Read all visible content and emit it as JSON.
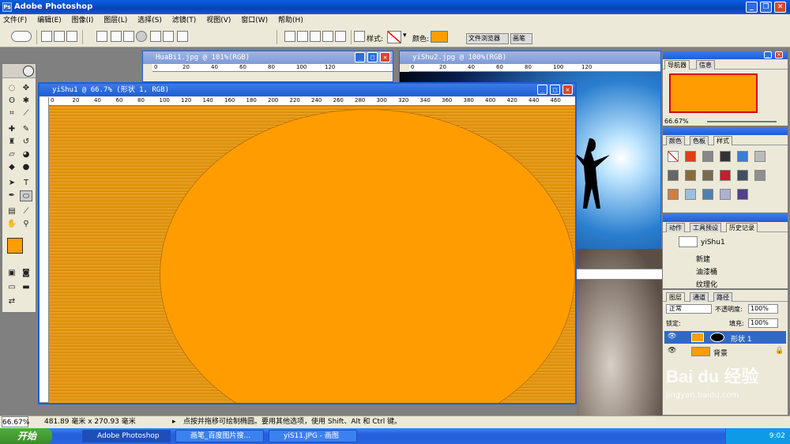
{
  "app": {
    "title": "Adobe Photoshop"
  },
  "menu": [
    "文件(F)",
    "编辑(E)",
    "图像(I)",
    "图层(L)",
    "选择(S)",
    "滤镜(T)",
    "视图(V)",
    "窗口(W)",
    "帮助(H)"
  ],
  "options": {
    "style_label": "样式:",
    "color_label": "颜色:",
    "color": "#ff9d00",
    "palette_well": [
      "文件浏览器",
      "画笔"
    ]
  },
  "documents": {
    "main": {
      "title": "yiShu1 @ 66.7% (形状 1, RGB)",
      "ruler": [
        "0",
        "20",
        "40",
        "60",
        "80",
        "100",
        "120",
        "140",
        "160",
        "180",
        "200",
        "220",
        "240",
        "260",
        "280",
        "300",
        "320",
        "340",
        "360",
        "380",
        "400",
        "420",
        "440",
        "460"
      ]
    },
    "doc2": {
      "title": "HuaBi1.jpg @ 101%(RGB)",
      "ruler": [
        "0",
        "20",
        "40",
        "60",
        "80",
        "100",
        "120"
      ]
    },
    "doc3": {
      "title": "yiShu2.jpg @ 100%(RGB)",
      "ruler": [
        "0",
        "20",
        "40",
        "60",
        "80",
        "100",
        "120"
      ]
    }
  },
  "navigator": {
    "tabs": [
      "导航器",
      "信息"
    ],
    "zoom": "66.67%"
  },
  "swatches": {
    "tabs": [
      "颜色",
      "色板",
      "样式"
    ]
  },
  "history": {
    "tabs": [
      "动作",
      "工具预设",
      "历史记录"
    ],
    "snapshot": "yiShu1",
    "items": [
      "新建",
      "油漆桶",
      "纹理化"
    ]
  },
  "layers": {
    "tabs": [
      "图层",
      "通道",
      "路径"
    ],
    "blend": "正常",
    "opacity_label": "不透明度:",
    "opacity": "100%",
    "lock_label": "锁定:",
    "fill_label": "填充:",
    "fill": "100%",
    "items": [
      "形状 1",
      "背景"
    ]
  },
  "status": {
    "zoom": "66.67%",
    "size": "481.89 毫米 x 270.93 毫米",
    "hint": "点按并拖移可绘制椭圆。要用其他选项，使用 Shift、Alt 和 Ctrl 键。"
  },
  "taskbar": {
    "start": "开始",
    "tasks": [
      "Adobe Photoshop",
      "画笔_百度图片搜...",
      "yiS11.JPG - 画图"
    ],
    "time": "9:02"
  },
  "watermark": {
    "brand": "Bai du 经验",
    "url": "jingyan.baidu.com"
  }
}
